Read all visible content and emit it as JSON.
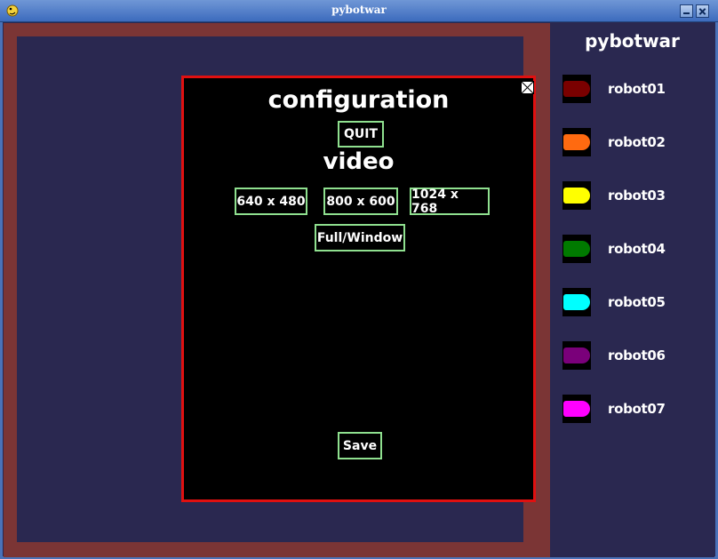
{
  "window": {
    "title": "pybotwar"
  },
  "side_panel": {
    "title": "pybotwar",
    "robots": [
      {
        "name": "robot01",
        "color": "#7a0000"
      },
      {
        "name": "robot02",
        "color": "#ff6a10"
      },
      {
        "name": "robot03",
        "color": "#ffff00"
      },
      {
        "name": "robot04",
        "color": "#007a00"
      },
      {
        "name": "robot05",
        "color": "#00ffff"
      },
      {
        "name": "robot06",
        "color": "#7a007a"
      },
      {
        "name": "robot07",
        "color": "#ff00ff"
      }
    ]
  },
  "dialog": {
    "title": "configuration",
    "quit_label": "QUIT",
    "video_heading": "video",
    "res_640": "640 x 480",
    "res_800": "800 x 600",
    "res_1024": "1024 x 768",
    "fullwindow_label": "Full/Window",
    "save_label": "Save"
  },
  "colors": {
    "arena_bg": "#2a2850",
    "arena_border": "#7b3535",
    "dialog_border": "#e01010",
    "button_border": "#8fe08f"
  }
}
